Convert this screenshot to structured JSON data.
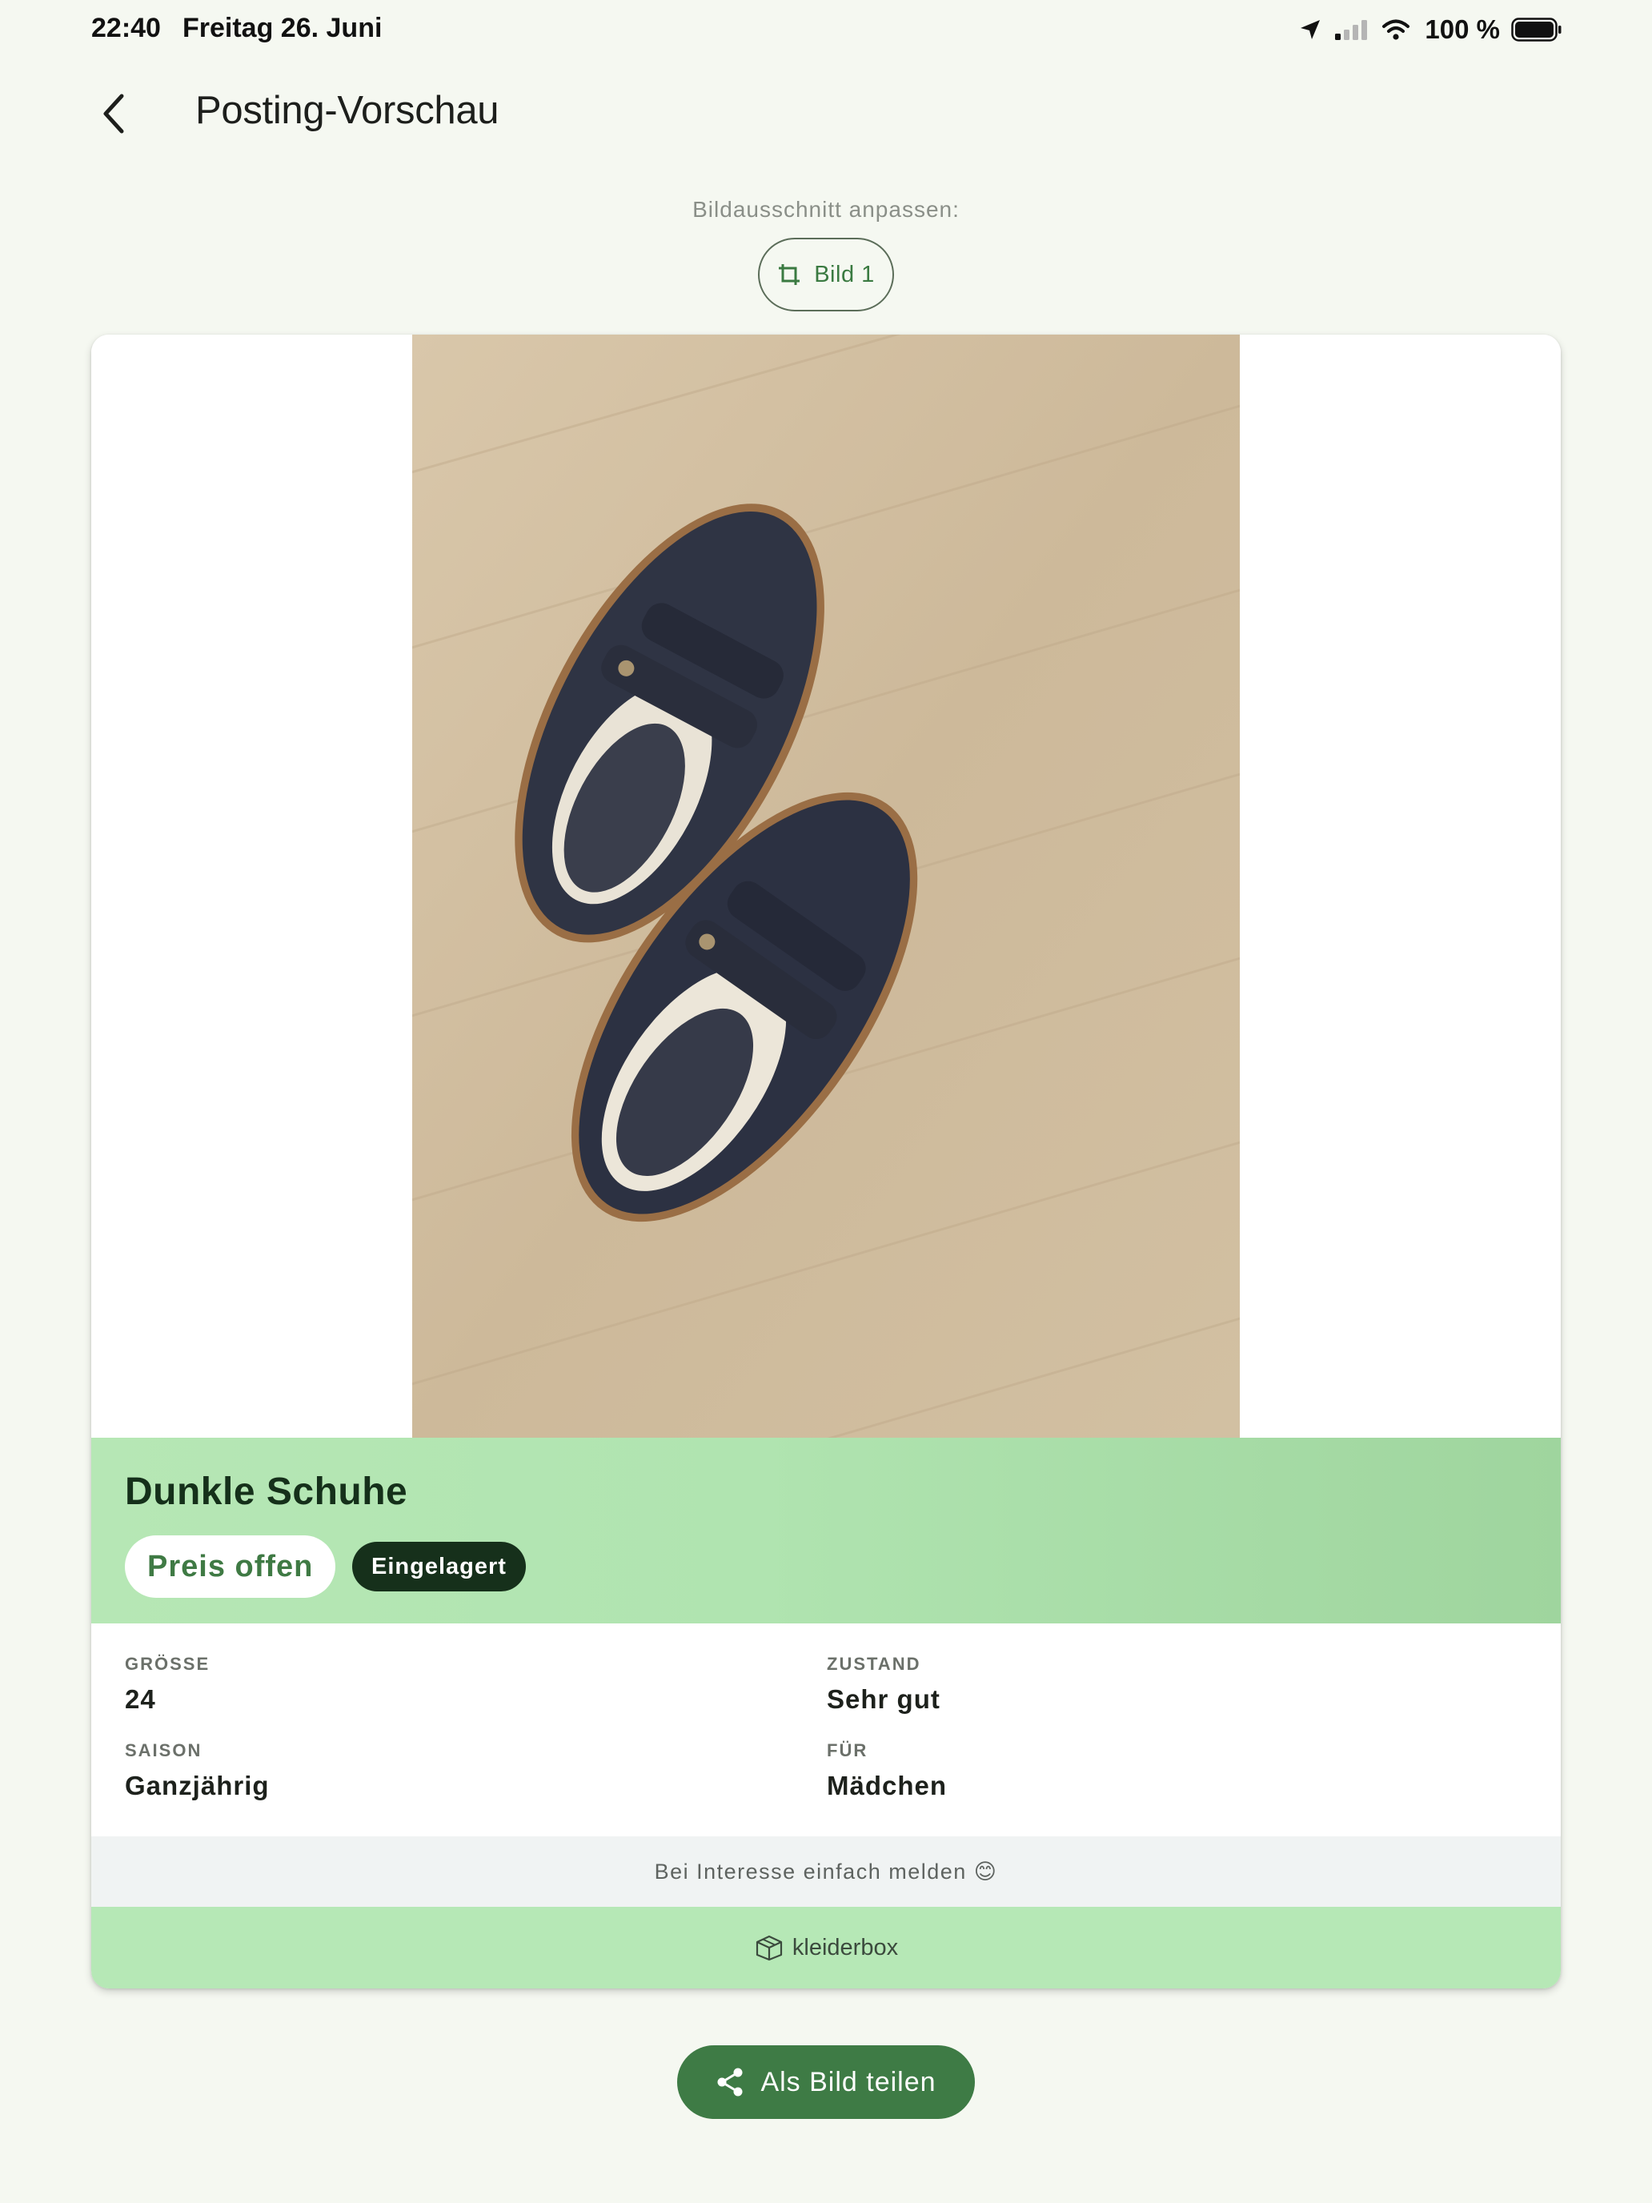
{
  "status_bar": {
    "time": "22:40",
    "date": "Freitag 26. Juni",
    "battery": "100 %"
  },
  "header": {
    "title": "Posting-Vorschau"
  },
  "crop": {
    "label": "Bildausschnitt anpassen:",
    "chip_label": "Bild 1"
  },
  "item": {
    "title": "Dunkle Schuhe",
    "price": "Preis offen",
    "status": "Eingelagert",
    "attributes": [
      {
        "label": "GRÖSSE",
        "value": "24"
      },
      {
        "label": "ZUSTAND",
        "value": "Sehr gut"
      },
      {
        "label": "SAISON",
        "value": "Ganzjährig"
      },
      {
        "label": "FÜR",
        "value": "Mädchen"
      }
    ],
    "note": "Bei Interesse einfach melden 😊",
    "brand": "kleiderbox"
  },
  "share": {
    "label": "Als Bild teilen"
  },
  "colors": {
    "accent": "#3e7b45",
    "band_green": "#b6e7b5",
    "dark_pill": "#16301b",
    "background": "#f5f8f1"
  }
}
